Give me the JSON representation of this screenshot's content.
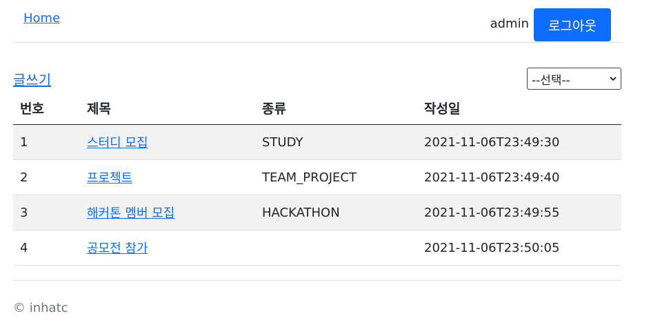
{
  "header": {
    "home_label": "Home",
    "user_name": "admin",
    "logout_label": "로그아웃"
  },
  "toolbar": {
    "write_label": "글쓰기",
    "category_select": {
      "selected": "--선택--"
    }
  },
  "table": {
    "columns": [
      "번호",
      "제목",
      "종류",
      "작성일"
    ],
    "rows": [
      {
        "no": "1",
        "title": "스터디 모집",
        "type": "STUDY",
        "date": "2021-11-06T23:49:30"
      },
      {
        "no": "2",
        "title": "프로젝트",
        "type": "TEAM_PROJECT",
        "date": "2021-11-06T23:49:40"
      },
      {
        "no": "3",
        "title": "해커톤 멤버 모집",
        "type": "HACKATHON",
        "date": "2021-11-06T23:49:55"
      },
      {
        "no": "4",
        "title": "공모전 참가",
        "type": "",
        "date": "2021-11-06T23:50:05"
      }
    ]
  },
  "footer": {
    "text": "© inhatc"
  },
  "colors": {
    "accent": "#0d6efd",
    "stripe": "#f2f2f2",
    "text": "#212529"
  }
}
